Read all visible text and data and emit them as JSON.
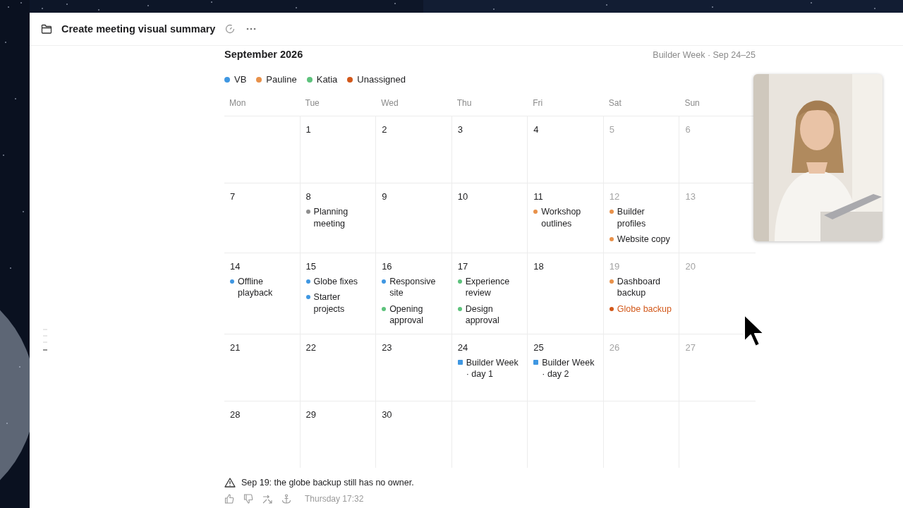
{
  "window": {
    "title": "Create meeting visual summary"
  },
  "calendar": {
    "month": "September 2026",
    "note": "Builder Week · Sep 24–25",
    "legend": [
      {
        "label": "VB",
        "color": "#3f97e2"
      },
      {
        "label": "Pauline",
        "color": "#e8914a"
      },
      {
        "label": "Katia",
        "color": "#5dc27c"
      },
      {
        "label": "Unassigned",
        "color": "#d2581a"
      }
    ],
    "weekdays": [
      "Mon",
      "Tue",
      "Wed",
      "Thu",
      "Fri",
      "Sat",
      "Sun"
    ],
    "weeks": [
      [
        {
          "kind": "blank"
        },
        {
          "kind": "day",
          "date": "1",
          "muted": false
        },
        {
          "kind": "day",
          "date": "2",
          "muted": false
        },
        {
          "kind": "day",
          "date": "3",
          "muted": false
        },
        {
          "kind": "day",
          "date": "4",
          "muted": false
        },
        {
          "kind": "day",
          "date": "5",
          "muted": true
        },
        {
          "kind": "day",
          "date": "6",
          "muted": true
        }
      ],
      [
        {
          "kind": "day",
          "date": "7",
          "muted": false
        },
        {
          "kind": "day",
          "date": "8",
          "muted": false,
          "events": [
            {
              "label": "Planning meeting",
              "color": "#8e8e8e",
              "kind": "dot",
              "emphasized": false
            }
          ]
        },
        {
          "kind": "day",
          "date": "9",
          "muted": false
        },
        {
          "kind": "day",
          "date": "10",
          "muted": false
        },
        {
          "kind": "day",
          "date": "11",
          "muted": false,
          "events": [
            {
              "label": "Workshop outlines",
              "color": "#e8914a",
              "kind": "dot",
              "emphasized": false
            }
          ]
        },
        {
          "kind": "day",
          "date": "12",
          "muted": true,
          "events": [
            {
              "label": "Builder profiles",
              "color": "#e8914a",
              "kind": "dot",
              "emphasized": false
            },
            {
              "label": "Website copy",
              "color": "#e8914a",
              "kind": "dot",
              "emphasized": false
            }
          ]
        },
        {
          "kind": "day",
          "date": "13",
          "muted": true
        }
      ],
      [
        {
          "kind": "day",
          "date": "14",
          "muted": false,
          "events": [
            {
              "label": "Offline playback",
              "color": "#3f97e2",
              "kind": "dot",
              "emphasized": false
            }
          ]
        },
        {
          "kind": "day",
          "date": "15",
          "muted": false,
          "events": [
            {
              "label": "Globe fixes",
              "color": "#3f97e2",
              "kind": "dot",
              "emphasized": false
            },
            {
              "label": "Starter projects",
              "color": "#3f97e2",
              "kind": "dot",
              "emphasized": false
            }
          ]
        },
        {
          "kind": "day",
          "date": "16",
          "muted": false,
          "events": [
            {
              "label": "Responsive site",
              "color": "#3f97e2",
              "kind": "dot",
              "emphasized": false
            },
            {
              "label": "Opening approval",
              "color": "#5dc27c",
              "kind": "dot",
              "emphasized": false
            }
          ]
        },
        {
          "kind": "day",
          "date": "17",
          "muted": false,
          "events": [
            {
              "label": "Experience review",
              "color": "#5dc27c",
              "kind": "dot",
              "emphasized": false
            },
            {
              "label": "Design approval",
              "color": "#5dc27c",
              "kind": "dot",
              "emphasized": false
            }
          ]
        },
        {
          "kind": "day",
          "date": "18",
          "muted": false
        },
        {
          "kind": "day",
          "date": "19",
          "muted": true,
          "events": [
            {
              "label": "Dashboard backup",
              "color": "#e8914a",
              "kind": "dot",
              "emphasized": false
            },
            {
              "label": "Globe backup",
              "color": "#d2581a",
              "kind": "dot",
              "emphasized": true
            }
          ]
        },
        {
          "kind": "day",
          "date": "20",
          "muted": true
        }
      ],
      [
        {
          "kind": "day",
          "date": "21",
          "muted": false
        },
        {
          "kind": "day",
          "date": "22",
          "muted": false
        },
        {
          "kind": "day",
          "date": "23",
          "muted": false
        },
        {
          "kind": "day",
          "date": "24",
          "muted": false,
          "events": [
            {
              "label": "Builder Week · day 1",
              "color": "#3f97e2",
              "kind": "square",
              "emphasized": false
            }
          ]
        },
        {
          "kind": "day",
          "date": "25",
          "muted": false,
          "events": [
            {
              "label": "Builder Week · day 2",
              "color": "#3f97e2",
              "kind": "square",
              "emphasized": false
            }
          ]
        },
        {
          "kind": "day",
          "date": "26",
          "muted": true
        },
        {
          "kind": "day",
          "date": "27",
          "muted": true
        }
      ],
      [
        {
          "kind": "day",
          "date": "28",
          "muted": false
        },
        {
          "kind": "day",
          "date": "29",
          "muted": false
        },
        {
          "kind": "day",
          "date": "30",
          "muted": false
        },
        {
          "kind": "blank"
        },
        {
          "kind": "blank"
        },
        {
          "kind": "blank"
        },
        {
          "kind": "blank"
        }
      ]
    ]
  },
  "message": {
    "alert": "Sep 19: the globe backup still has no owner.",
    "timestamp": "Thursday 17:32"
  }
}
